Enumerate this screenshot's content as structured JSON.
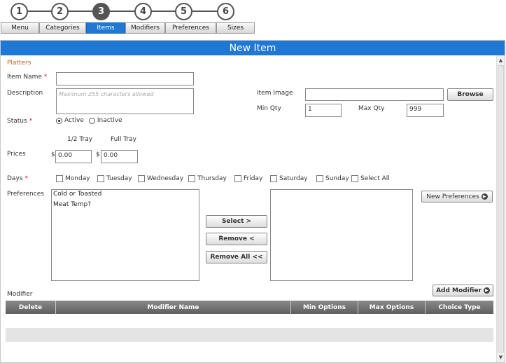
{
  "wizard": {
    "steps": [
      {
        "number": "1",
        "label": "Menu"
      },
      {
        "number": "2",
        "label": "Categories"
      },
      {
        "number": "3",
        "label": "Items"
      },
      {
        "number": "4",
        "label": "Modifiers"
      },
      {
        "number": "5",
        "label": "Preferences"
      },
      {
        "number": "6",
        "label": "Sizes"
      }
    ],
    "active_step": "3"
  },
  "panel": {
    "title": "New Item"
  },
  "form": {
    "section": "Platters",
    "item_name": {
      "label": "Item Name",
      "required_mark": "*",
      "value": ""
    },
    "description": {
      "label": "Description",
      "placeholder": "Maximum 255 characters allowed",
      "value": ""
    },
    "item_image": {
      "label": "Item Image",
      "value": "",
      "browse_label": "Browse"
    },
    "min_qty": {
      "label": "Min Qty",
      "value": "1"
    },
    "max_qty": {
      "label": "Max Qty",
      "value": "999"
    },
    "status": {
      "label": "Status",
      "required_mark": "*",
      "options": [
        "Active",
        "Inactive"
      ],
      "selected": "Active"
    },
    "prices": {
      "label": "Prices",
      "headers": [
        "1/2 Tray",
        "Full Tray"
      ],
      "currency": "$",
      "values": [
        "0.00",
        "0.00"
      ]
    },
    "days": {
      "label": "Days",
      "required_mark": "*",
      "options": [
        "Monday",
        "Tuesday",
        "Wednesday",
        "Thursday",
        "Friday",
        "Saturday",
        "Sunday",
        "Select All"
      ]
    },
    "preferences": {
      "label": "Preferences",
      "available": [
        "Cold or Toasted",
        "Meat Temp?"
      ],
      "selected": [],
      "select_label": "Select >",
      "remove_label": "Remove <",
      "remove_all_label": "Remove All <<",
      "new_label": "New Preferences"
    },
    "modifier": {
      "label": "Modifier",
      "add_label": "Add Modifier",
      "columns": [
        "Delete",
        "Modifier Name",
        "Min Options",
        "Max Options",
        "Choice Type"
      ]
    }
  },
  "colors": {
    "accent": "#1e78d4",
    "required": "#cc2222",
    "section": "#c06020"
  }
}
